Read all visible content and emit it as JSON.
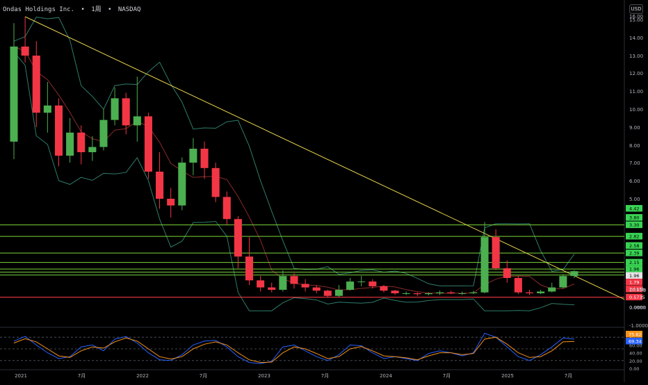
{
  "header": {
    "symbol": "Ondas Holdings Inc.",
    "sep1": "•",
    "interval": "1周",
    "sep2": "•",
    "exchange": "NASDAQ",
    "currency_button": "USD"
  },
  "colors": {
    "up": "#4caf50",
    "down": "#f23645",
    "trendline": "#e8d44d",
    "level_line": "#7cd63a",
    "support_line": "#f23645",
    "bollinger": "#2e7d6b",
    "ma": "#8a2b2b",
    "stoch_k": "#2962ff",
    "stoch_d": "#f7931a"
  },
  "chart_data": [
    {
      "type": "candlestick",
      "y_ticks": [
        "16.00",
        "15.00",
        "14.00",
        "13.00",
        "12.00",
        "11.00",
        "10.00",
        "9.00",
        "8.00",
        "7.00",
        "6.00",
        "5.00",
        "1.0000",
        "0.0000",
        "-1.0000"
      ],
      "x_ticks": [
        "2021",
        "7月",
        "2022",
        "7月",
        "2023",
        "7月",
        "2024",
        "7月",
        "2025",
        "7月"
      ],
      "series": [
        {
          "values": [
            [
              0,
              8.2,
              14.8,
              7.2,
              13.5
            ],
            [
              1,
              13.5,
              15.8,
              12.6,
              13.0
            ],
            [
              2,
              13.0,
              13.8,
              9.0,
              9.8
            ],
            [
              3,
              9.8,
              11.5,
              8.7,
              10.2
            ],
            [
              4,
              10.2,
              10.6,
              6.8,
              7.4
            ],
            [
              5,
              7.4,
              9.5,
              7.0,
              8.7
            ],
            [
              6,
              8.7,
              9.1,
              6.9,
              7.6
            ],
            [
              7,
              7.6,
              8.5,
              7.1,
              7.9
            ],
            [
              8,
              7.9,
              10.0,
              7.7,
              9.4
            ],
            [
              9,
              9.4,
              11.2,
              9.1,
              10.6
            ],
            [
              10,
              10.6,
              10.9,
              8.6,
              9.1
            ],
            [
              11,
              9.1,
              11.8,
              8.2,
              9.6
            ],
            [
              12,
              9.6,
              9.8,
              6.1,
              6.5
            ],
            [
              13,
              6.5,
              7.6,
              4.4,
              5.0
            ],
            [
              14,
              5.0,
              5.6,
              3.8,
              4.6
            ],
            [
              15,
              4.6,
              7.3,
              4.3,
              7.0
            ],
            [
              16,
              7.0,
              8.4,
              6.3,
              7.8
            ],
            [
              17,
              7.8,
              8.2,
              6.1,
              6.7
            ],
            [
              18,
              6.7,
              7.0,
              4.8,
              5.1
            ],
            [
              19,
              5.1,
              5.4,
              3.3,
              3.7
            ],
            [
              20,
              3.7,
              3.9,
              2.0,
              2.3
            ],
            [
              21,
              2.3,
              2.8,
              1.2,
              1.4
            ],
            [
              22,
              1.4,
              1.6,
              0.9,
              1.1
            ],
            [
              23,
              1.1,
              1.3,
              0.85,
              1.0
            ],
            [
              24,
              1.0,
              1.9,
              0.9,
              1.6
            ],
            [
              25,
              1.6,
              1.75,
              1.05,
              1.25
            ],
            [
              26,
              1.25,
              1.45,
              0.9,
              1.1
            ],
            [
              27,
              1.1,
              1.2,
              0.8,
              0.95
            ],
            [
              28,
              0.95,
              1.0,
              0.55,
              0.65
            ],
            [
              29,
              0.65,
              1.2,
              0.6,
              1.0
            ],
            [
              30,
              1.0,
              1.5,
              0.95,
              1.35
            ],
            [
              31,
              1.35,
              1.6,
              1.15,
              1.35
            ],
            [
              32,
              1.35,
              1.45,
              1.05,
              1.15
            ],
            [
              33,
              1.15,
              1.2,
              0.85,
              0.95
            ],
            [
              34,
              0.95,
              1.0,
              0.7,
              0.8
            ],
            [
              35,
              0.8,
              0.9,
              0.7,
              0.8
            ],
            [
              36,
              0.8,
              0.85,
              0.65,
              0.75
            ],
            [
              37,
              0.75,
              0.85,
              0.68,
              0.8
            ],
            [
              38,
              0.8,
              0.95,
              0.7,
              0.85
            ],
            [
              39,
              0.85,
              0.95,
              0.75,
              0.8
            ],
            [
              40,
              0.8,
              0.9,
              0.7,
              0.8
            ],
            [
              41,
              0.8,
              0.95,
              0.75,
              0.85
            ],
            [
              42,
              0.85,
              3.5,
              0.8,
              2.8
            ],
            [
              43,
              2.8,
              3.0,
              1.9,
              2.0
            ],
            [
              44,
              2.0,
              2.2,
              1.3,
              1.5
            ],
            [
              45,
              1.5,
              1.6,
              0.75,
              0.85
            ],
            [
              46,
              0.85,
              1.0,
              0.7,
              0.8
            ],
            [
              47,
              0.8,
              1.0,
              0.75,
              0.9
            ],
            [
              48,
              0.9,
              1.3,
              0.85,
              1.1
            ],
            [
              49,
              1.1,
              1.7,
              1.05,
              1.6
            ],
            [
              50,
              1.6,
              1.9,
              1.5,
              1.85
            ]
          ]
        }
      ],
      "price_labels": [
        "4.42",
        "3.80",
        "3.30",
        "2.82",
        "2.58",
        "2.39",
        "2.15",
        "1.96",
        "1.96",
        "1.79",
        "2d 15h",
        "1.0000",
        "0.5735",
        "0.0000"
      ],
      "levels": [
        3.3,
        2.82,
        2.39,
        2.15,
        1.96,
        1.8,
        1.65
      ],
      "support": 0.5735,
      "price_range": [
        -1.0,
        16.0
      ],
      "time_range": [
        0,
        51
      ]
    },
    {
      "type": "line",
      "y_ticks": [
        "80.00",
        "60.00",
        "40.00",
        "20.00",
        "0.00"
      ],
      "value_labels": [
        "75.62",
        "69.34"
      ],
      "series": [
        {
          "values": [
            70,
            82,
            60,
            40,
            25,
            30,
            55,
            60,
            45,
            75,
            82,
            65,
            40,
            22,
            20,
            35,
            60,
            70,
            72,
            55,
            30,
            15,
            12,
            18,
            55,
            60,
            45,
            30,
            20,
            35,
            60,
            58,
            40,
            25,
            30,
            25,
            20,
            38,
            45,
            40,
            32,
            40,
            90,
            80,
            55,
            30,
            20,
            35,
            55,
            78,
            75
          ]
        },
        {
          "values": [
            65,
            76,
            68,
            50,
            32,
            28,
            45,
            55,
            52,
            68,
            78,
            70,
            50,
            30,
            24,
            30,
            50,
            62,
            68,
            60,
            40,
            22,
            15,
            16,
            40,
            55,
            50,
            38,
            25,
            30,
            50,
            56,
            45,
            32,
            30,
            27,
            22,
            32,
            40,
            40,
            35,
            38,
            75,
            80,
            62,
            40,
            28,
            30,
            45,
            68,
            69
          ]
        }
      ],
      "guides": [
        80,
        50,
        20
      ],
      "ylim": [
        0,
        100
      ]
    }
  ]
}
